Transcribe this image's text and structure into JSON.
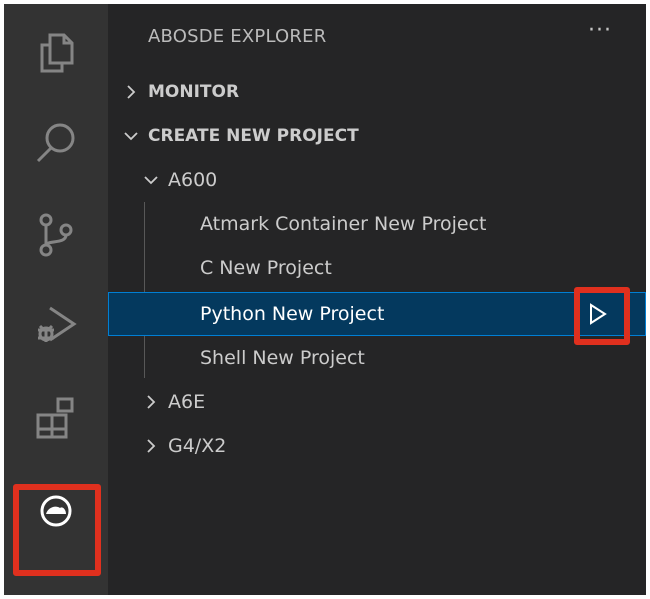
{
  "activity_bar": {
    "items": [
      {
        "icon": "files-icon"
      },
      {
        "icon": "search-icon"
      },
      {
        "icon": "source-control-icon"
      },
      {
        "icon": "run-debug-icon"
      },
      {
        "icon": "extensions-icon"
      },
      {
        "icon": "abosde-icon"
      }
    ],
    "highlight_color": "#e0301e"
  },
  "sidebar": {
    "title": "ABOSDE EXPLORER",
    "more_label": "···",
    "sections": {
      "monitor": {
        "label": "MONITOR",
        "expanded": false
      },
      "create_new_project": {
        "label": "CREATE NEW PROJECT",
        "expanded": true
      }
    },
    "groups": {
      "a600": {
        "label": "A600",
        "expanded": true
      },
      "a6e": {
        "label": "A6E",
        "expanded": false
      },
      "g4x2": {
        "label": "G4/X2",
        "expanded": false
      }
    },
    "a600_items": [
      {
        "label": "Atmark Container New Project"
      },
      {
        "label": "C New Project"
      },
      {
        "label": "Python New Project",
        "selected": true
      },
      {
        "label": "Shell New Project"
      }
    ],
    "run_action_icon": "play-icon"
  },
  "colors": {
    "background": "#252526",
    "activity_bar": "#333333",
    "selection": "#04395e",
    "selection_border": "#007fd4",
    "highlight": "#e0301e"
  }
}
